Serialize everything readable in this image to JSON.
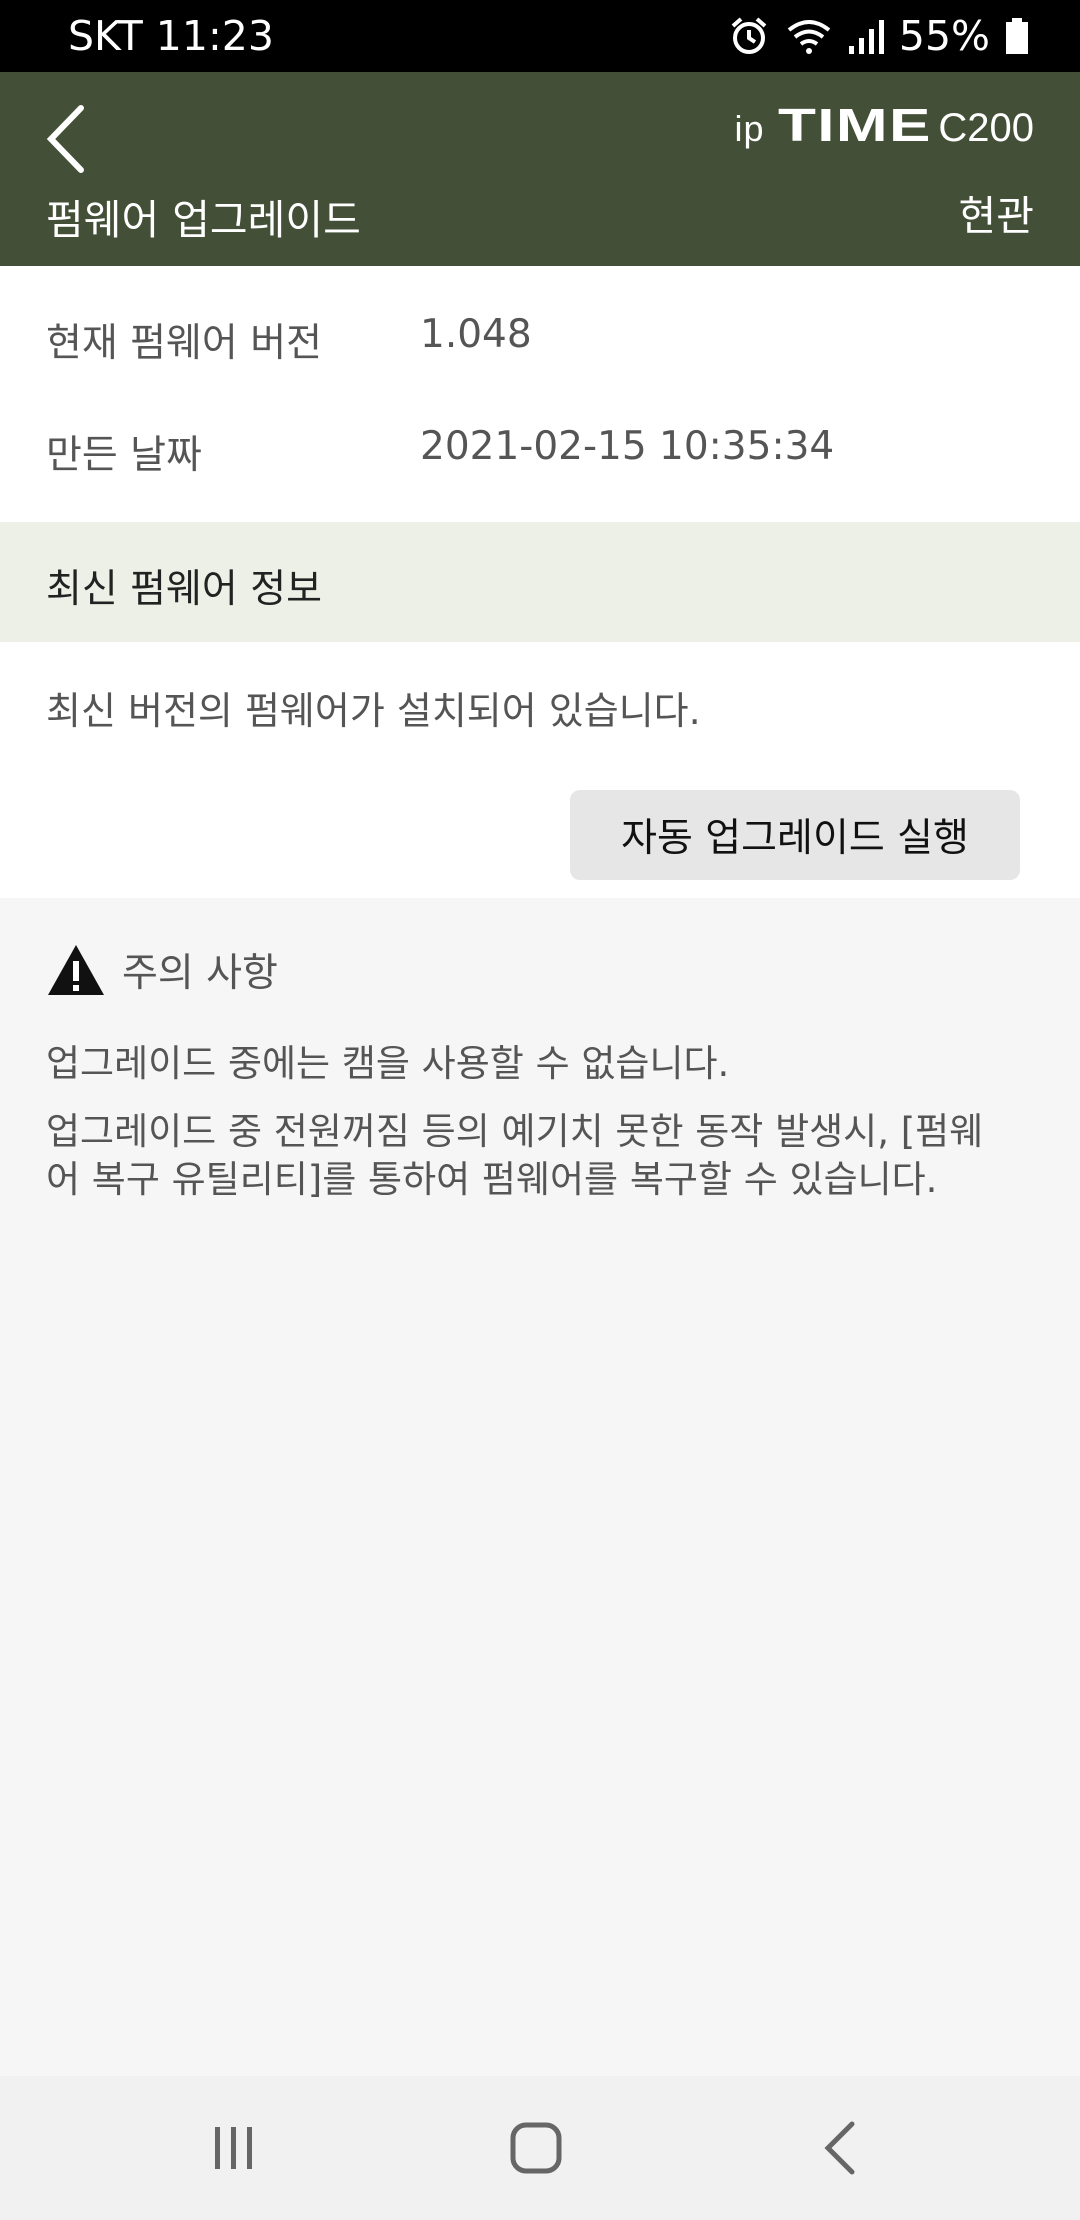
{
  "status_bar": {
    "carrier_time": "SKT 11:23",
    "battery": "55%",
    "icons": [
      "alarm-icon",
      "wifi-icon",
      "signal-icon",
      "battery-icon"
    ]
  },
  "header": {
    "back_icon": "chevron-left-icon",
    "logo_ip": "ip",
    "logo_time": "TIME",
    "logo_model": "C200",
    "title": "펌웨어 업그레이드",
    "right_action": "현관",
    "background": "#435037"
  },
  "current_info": {
    "rows": [
      {
        "label": "현재 펌웨어 버전",
        "value": "1.048"
      },
      {
        "label": "만든 날짜",
        "value": "2021-02-15 10:35:34"
      }
    ]
  },
  "latest": {
    "section_title": "최신 펌웨어 정보",
    "message": "최신 버전의 펌웨어가 설치되어 있습니다.",
    "button_label": "자동 업그레이드 실행",
    "section_bg": "#edf0e6"
  },
  "caution": {
    "icon": "warning-icon",
    "title": "주의 사항",
    "lines": [
      "업그레이드 중에는 캠을 사용할 수 없습니다.",
      "업그레이드 중 전원꺼짐 등의 예기치 못한 동작 발생시, [펌웨어 복구 유틸리티]를 통하여 펌웨어를 복구할 수 있습니다."
    ]
  },
  "nav": {
    "buttons": [
      "recents-icon",
      "home-icon",
      "back-icon"
    ]
  }
}
